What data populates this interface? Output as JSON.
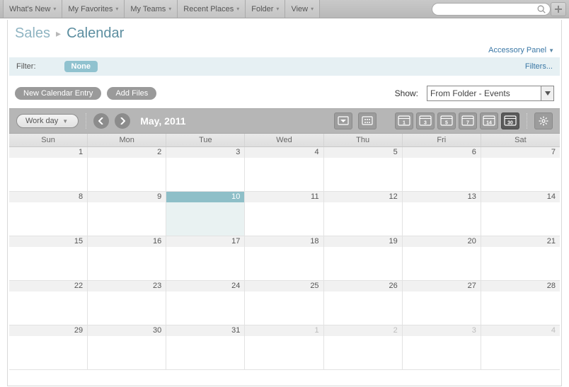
{
  "nav": {
    "items": [
      {
        "label": "What's New"
      },
      {
        "label": "My Favorites"
      },
      {
        "label": "My Teams"
      },
      {
        "label": "Recent Places"
      },
      {
        "label": "Folder"
      },
      {
        "label": "View"
      }
    ],
    "search_placeholder": ""
  },
  "breadcrumb": {
    "root": "Sales",
    "leaf": "Calendar"
  },
  "accessory_panel_label": "Accessory Panel",
  "filter": {
    "label": "Filter:",
    "none": "None",
    "filters_link": "Filters..."
  },
  "toolbar": {
    "new_entry": "New Calendar Entry",
    "add_files": "Add Files"
  },
  "show": {
    "label": "Show:",
    "selected": "From Folder - Events"
  },
  "calendar": {
    "workday_label": "Work day",
    "month_label": "May, 2011",
    "day_headers": [
      "Sun",
      "Mon",
      "Tue",
      "Wed",
      "Thu",
      "Fri",
      "Sat"
    ],
    "weeks": [
      [
        {
          "n": 1
        },
        {
          "n": 2
        },
        {
          "n": 3
        },
        {
          "n": 4
        },
        {
          "n": 5
        },
        {
          "n": 6
        },
        {
          "n": 7
        }
      ],
      [
        {
          "n": 8
        },
        {
          "n": 9
        },
        {
          "n": 10,
          "today": true
        },
        {
          "n": 11
        },
        {
          "n": 12
        },
        {
          "n": 13
        },
        {
          "n": 14
        }
      ],
      [
        {
          "n": 15
        },
        {
          "n": 16
        },
        {
          "n": 17
        },
        {
          "n": 18
        },
        {
          "n": 19
        },
        {
          "n": 20
        },
        {
          "n": 21
        }
      ],
      [
        {
          "n": 22
        },
        {
          "n": 23
        },
        {
          "n": 24
        },
        {
          "n": 25
        },
        {
          "n": 26
        },
        {
          "n": 27
        },
        {
          "n": 28
        }
      ],
      [
        {
          "n": 29
        },
        {
          "n": 30
        },
        {
          "n": 31
        },
        {
          "n": 1,
          "other": true
        },
        {
          "n": 2,
          "other": true
        },
        {
          "n": 3,
          "other": true
        },
        {
          "n": 4,
          "other": true
        }
      ]
    ],
    "range_icons": [
      "1",
      "3",
      "5",
      "7",
      "14",
      "30"
    ],
    "active_range_index": 5
  }
}
